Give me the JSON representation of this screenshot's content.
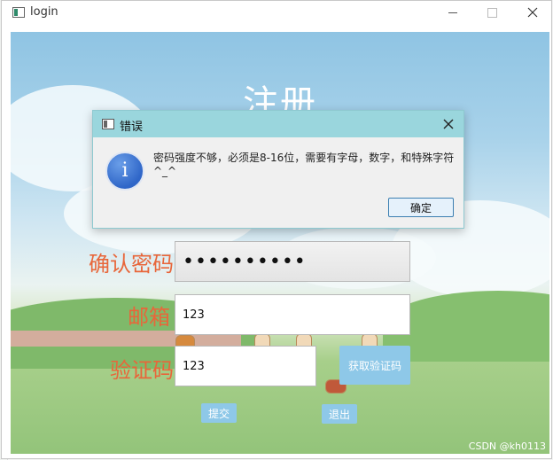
{
  "window": {
    "title": "login"
  },
  "form": {
    "title": "注册",
    "confirm_password": {
      "label": "确认密码",
      "value": "••••••••••"
    },
    "email": {
      "label": "邮箱",
      "value": "123"
    },
    "code": {
      "label": "验证码",
      "value": "123",
      "button": "获取验证码"
    },
    "submit_label": "提交",
    "exit_label": "退出"
  },
  "dialog": {
    "title": "错误",
    "message": "密码强度不够，必须是8-16位，需要有字母，数字，和特殊字符^_^",
    "ok_label": "确定",
    "icon": "info-icon"
  },
  "watermark": "CSDN @kh0113",
  "colors": {
    "label": "#e8663a",
    "button": "#8ec8e8",
    "dialog_titlebar": "#9ad6dd"
  }
}
